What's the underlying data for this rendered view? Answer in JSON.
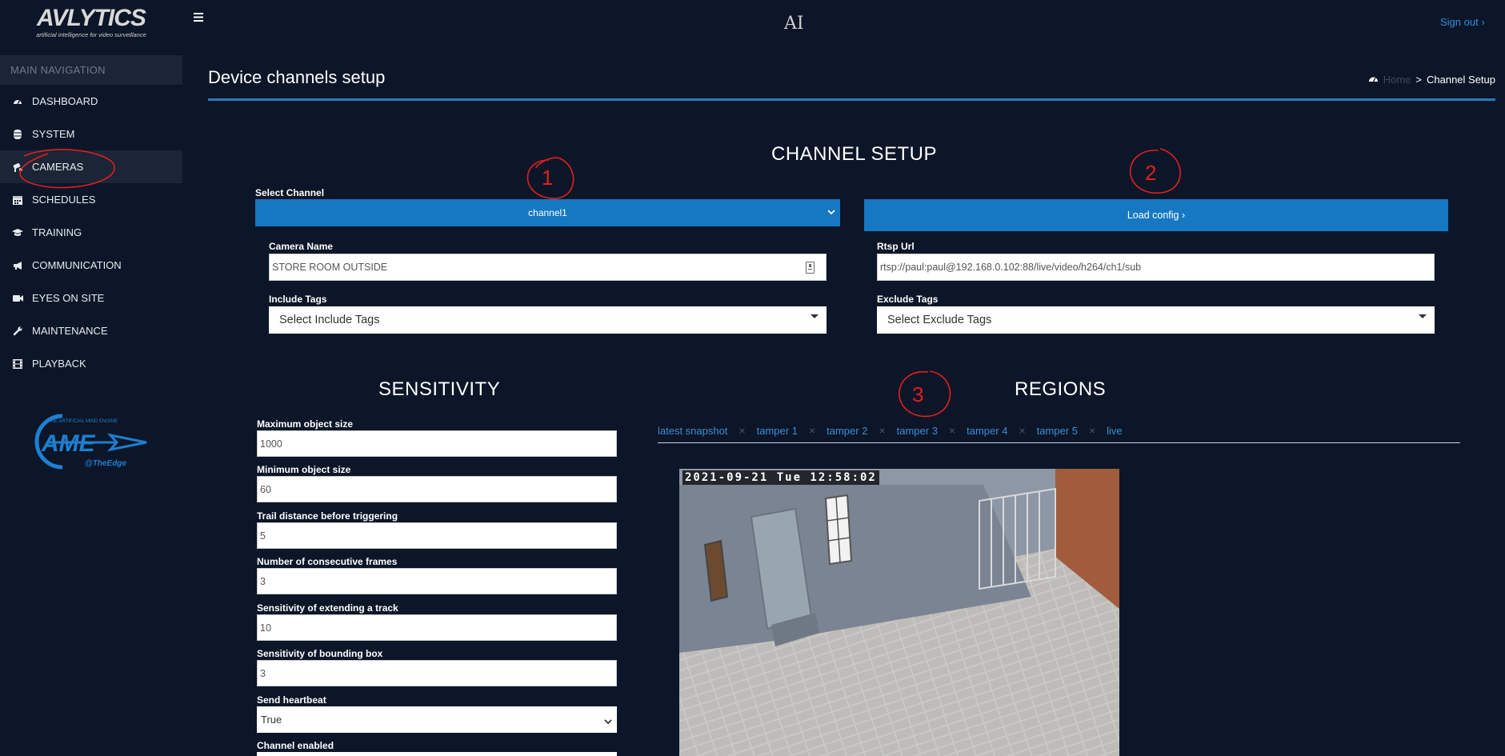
{
  "app": {
    "logo_main": "AVLYTICS",
    "logo_sub": "artificial intelligence for video surveillance",
    "sign_out": "Sign out ›"
  },
  "sidebar": {
    "header": "MAIN NAVIGATION",
    "items": [
      {
        "label": "DASHBOARD",
        "icon": "dashboard-icon"
      },
      {
        "label": "SYSTEM",
        "icon": "database-icon"
      },
      {
        "label": "CAMERAS",
        "icon": "camera-icon"
      },
      {
        "label": "SCHEDULES",
        "icon": "calendar-icon"
      },
      {
        "label": "TRAINING",
        "icon": "graduation-cap-icon"
      },
      {
        "label": "COMMUNICATION",
        "icon": "megaphone-icon"
      },
      {
        "label": "EYES ON SITE",
        "icon": "video-icon"
      },
      {
        "label": "MAINTENANCE",
        "icon": "wrench-icon"
      },
      {
        "label": "PLAYBACK",
        "icon": "film-icon"
      }
    ],
    "ame_top": "THE ARTIFICIAL MIND ENGINE",
    "ame_mark": "AME",
    "ame_sub": "@TheEdge"
  },
  "header": {
    "center_mark": "AI",
    "page_title": "Device channels setup",
    "breadcrumb_home": "Home",
    "breadcrumb_sep": ">",
    "breadcrumb_current": "Channel Setup"
  },
  "channel_setup": {
    "title": "CHANNEL SETUP",
    "select_channel_label": "Select Channel",
    "select_channel_value": "channel1",
    "load_config": "Load config ›",
    "camera_name_label": "Camera Name",
    "camera_name_value": "STORE ROOM OUTSIDE",
    "rtsp_label": "Rtsp Url",
    "rtsp_value": "rtsp://paul:paul@192.168.0.102:88/live/video/h264/ch1/sub",
    "include_tags_label": "Include Tags",
    "include_tags_placeholder": "Select Include Tags",
    "exclude_tags_label": "Exclude Tags",
    "exclude_tags_placeholder": "Select Exclude Tags"
  },
  "sensitivity": {
    "title": "SENSITIVITY",
    "fields": [
      {
        "label": "Maximum object size",
        "value": "1000"
      },
      {
        "label": "Minimum object size",
        "value": "60"
      },
      {
        "label": "Trail distance before triggering",
        "value": "5"
      },
      {
        "label": "Number of consecutive frames",
        "value": "3"
      },
      {
        "label": "Sensitivity of extending a track",
        "value": "10"
      },
      {
        "label": "Sensitivity of bounding box",
        "value": "3"
      }
    ],
    "heartbeat_label": "Send heartbeat",
    "heartbeat_value": "True",
    "channel_enabled_label": "Channel enabled"
  },
  "regions": {
    "title": "REGIONS",
    "tabs": [
      "latest snapshot",
      "tamper 1",
      "tamper 2",
      "tamper 3",
      "tamper 4",
      "tamper 5",
      "live"
    ],
    "close_glyph": "×",
    "camera_timestamp": "2021-09-21 Tue 12:58:02"
  },
  "annotations": [
    "1",
    "2",
    "3"
  ],
  "colors": {
    "background": "#0c1628",
    "sidebar_active": "#1b2535",
    "accent_blue": "#1678c2",
    "link_blue": "#3b8fd6",
    "annotation_red": "#e0201f"
  }
}
